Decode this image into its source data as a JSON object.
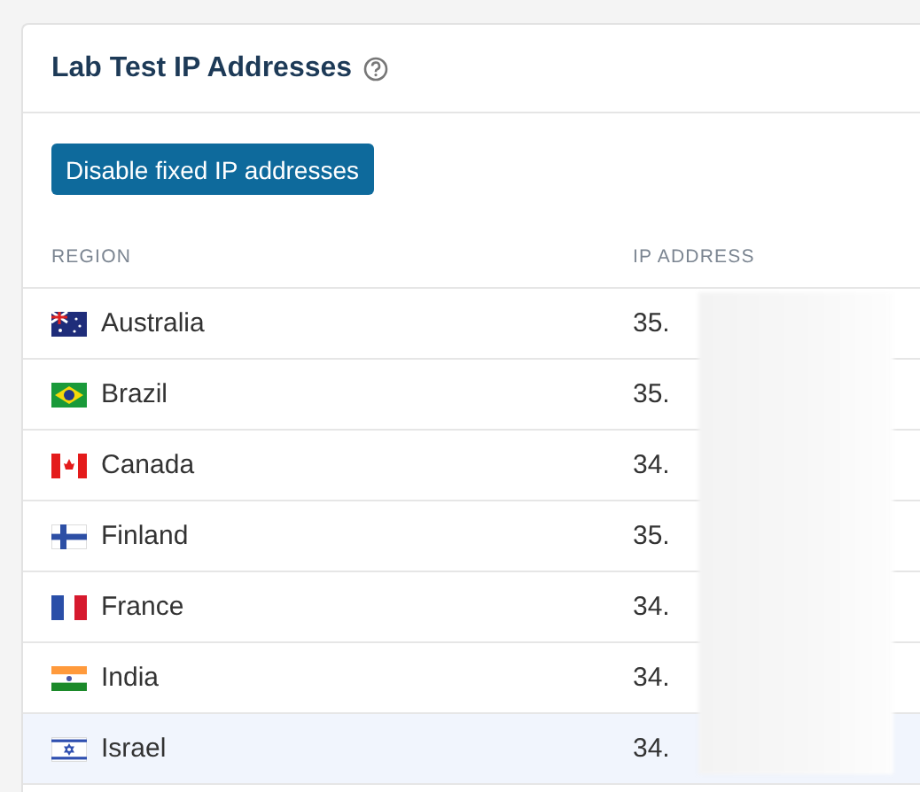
{
  "card": {
    "title": "Lab Test IP Addresses",
    "button": "Disable fixed IP addresses"
  },
  "table": {
    "columns": [
      "REGION",
      "IP ADDRESS"
    ],
    "rows": [
      {
        "region": "Australia",
        "ip": "35.",
        "selected": false
      },
      {
        "region": "Brazil",
        "ip": "35.",
        "selected": false
      },
      {
        "region": "Canada",
        "ip": "34.",
        "selected": false
      },
      {
        "region": "Finland",
        "ip": "35.",
        "selected": false
      },
      {
        "region": "France",
        "ip": "34.",
        "selected": false
      },
      {
        "region": "India",
        "ip": "34.",
        "selected": false
      },
      {
        "region": "Israel",
        "ip": "34.",
        "selected": true
      }
    ]
  }
}
